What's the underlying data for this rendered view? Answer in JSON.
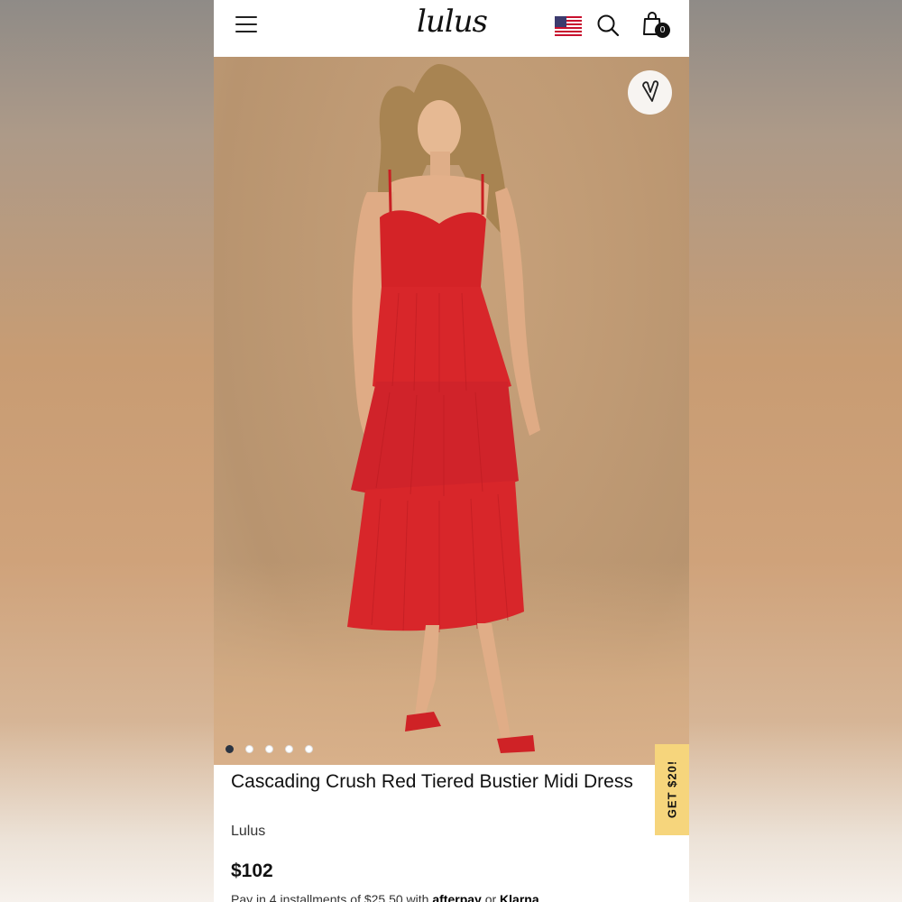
{
  "header": {
    "logo_text": "lulus",
    "cart_count": "0",
    "icons": [
      "menu-icon",
      "us-flag-icon",
      "search-icon",
      "shopping-bag-icon"
    ]
  },
  "hero": {
    "image_description_icon": "product-photo",
    "wishlist_icon": "heart-icon",
    "carousel_dots": 5,
    "active_dot": 0
  },
  "product": {
    "title": "Cascading Crush Red Tiered Bustier Midi Dress",
    "brand": "Lulus",
    "price": "$102",
    "installments_prefix": "Pay in 4 installments of $25.50 with ",
    "afterpay_label": "afterpay",
    "installments_mid": " or ",
    "klarna_label": "Klarna"
  },
  "promo": {
    "label": "GET $20!",
    "color": "#f6d57c"
  },
  "colors": {
    "dress": "#d8262a",
    "backdrop": "#c29d77",
    "dot_active": "#2b3442"
  }
}
